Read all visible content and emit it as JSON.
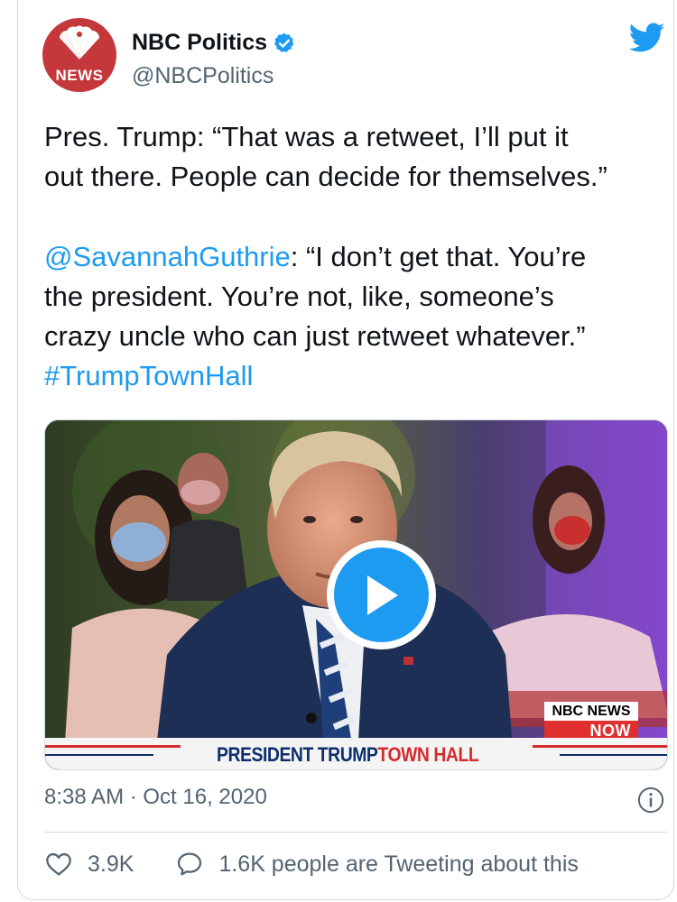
{
  "tweet": {
    "author_name": "NBC Politics",
    "author_handle": "@NBCPolitics",
    "avatar_text": "NEWS",
    "line1": "Pres. Trump: “That was a retweet, I’ll put it",
    "line2": "out there. People can decide for themselves.”",
    "mention": "@SavannahGuthrie",
    "line3_rest": ": “I don’t get that. You’re",
    "line4": "the president. You’re not, like, someone’s",
    "line5": "crazy uncle who can just retweet whatever.”",
    "hashtag": "#TrumpTownHall",
    "timestamp": "8:38 AM · Oct 16, 2020",
    "likes": "3.9K",
    "tweeting_about": "1.6K people are Tweeting about this"
  },
  "video": {
    "badge_top": "NBC NEWS",
    "badge_bottom": "NOW",
    "banner_part1": "PRESIDENT TRUMP",
    "banner_part2": "TOWN HALL"
  },
  "colors": {
    "accent": "#1d9bf0",
    "nbc_red": "#c4373b",
    "text_secondary": "#536471",
    "banner_navy": "#0e2f6e",
    "banner_red": "#d42c2e"
  },
  "icons": [
    "nbc-peacock-icon",
    "verified-badge-icon",
    "twitter-bird-icon",
    "play-icon",
    "info-icon",
    "heart-icon",
    "comment-icon"
  ]
}
